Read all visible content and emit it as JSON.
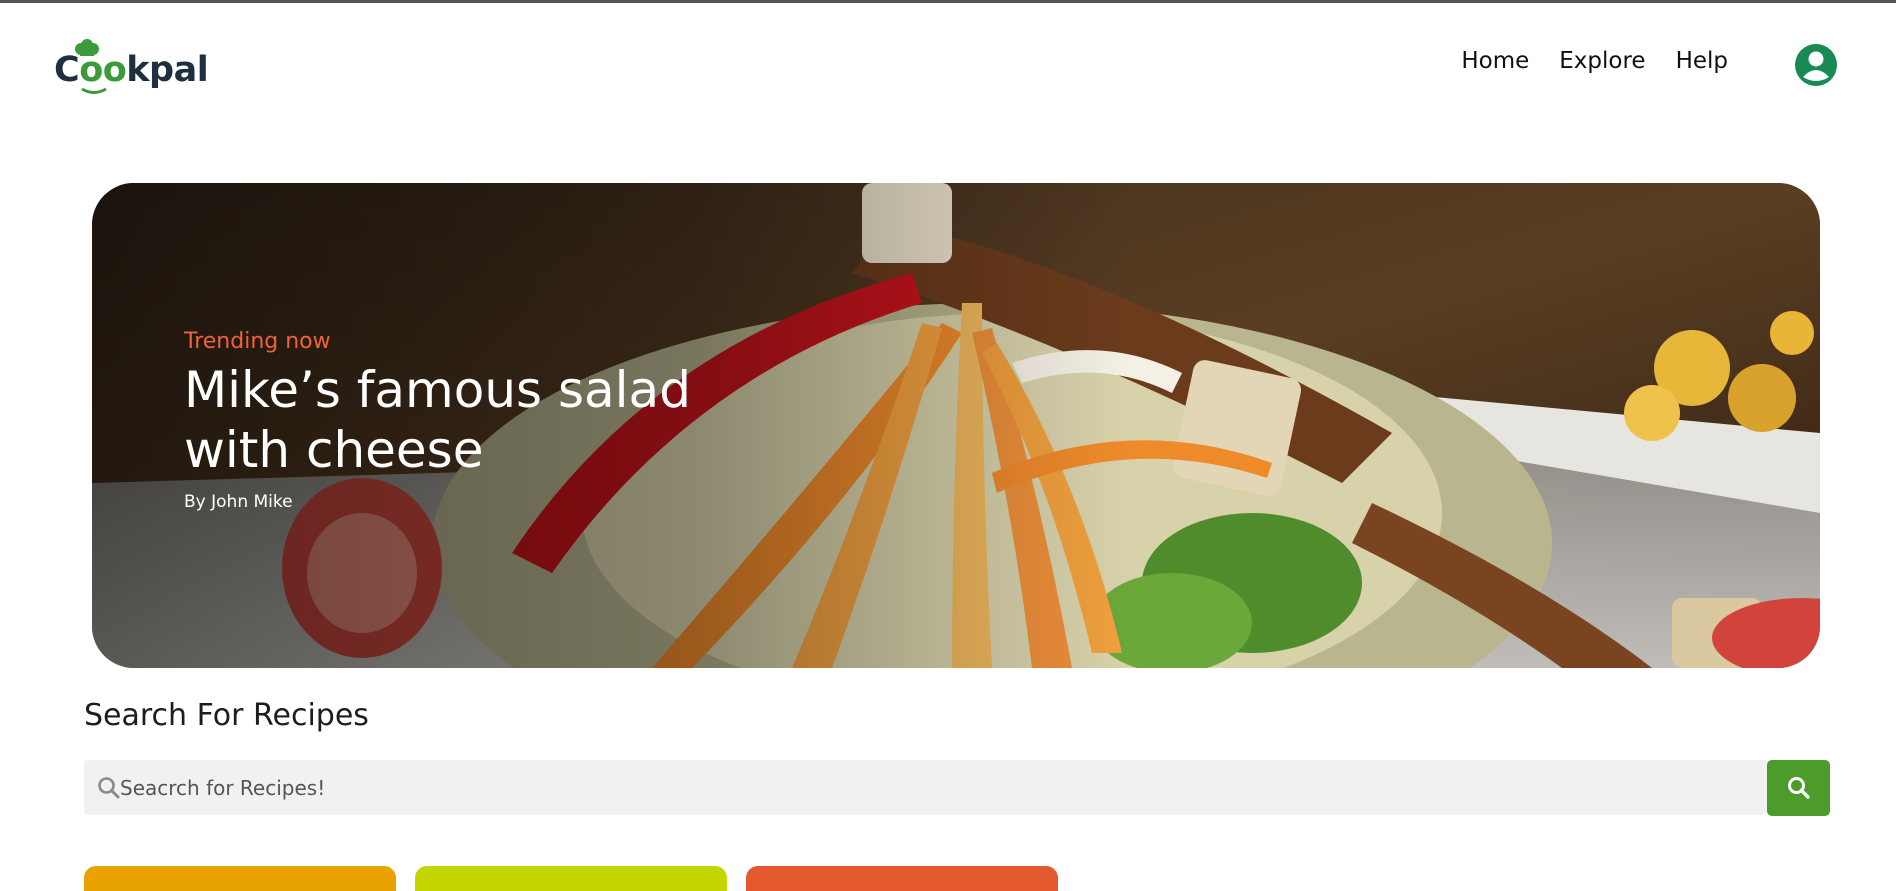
{
  "brand": {
    "name_part1": "C",
    "name_part2": "oo",
    "name_part3": "kpal",
    "green": "#3d9a3a",
    "dark": "#1f2f3f"
  },
  "nav": {
    "items": [
      {
        "label": "Home"
      },
      {
        "label": "Explore"
      },
      {
        "label": "Help"
      }
    ]
  },
  "hero": {
    "tag": "Trending now",
    "title_line1": "Mike’s famous salad",
    "title_line2": "with cheese",
    "author": "By John Mike",
    "tag_color": "#f0613a"
  },
  "search": {
    "heading": "Search For Recipes",
    "placeholder": "Seacrch for Recipes!",
    "value": "",
    "button_color": "#4c9b2b"
  },
  "categories": [
    {
      "color": "#e9a300"
    },
    {
      "color": "#c4d600"
    },
    {
      "color": "#e3582c"
    }
  ],
  "icons": {
    "avatar": "user-circle-icon",
    "search": "search-icon",
    "chef_hat": "chef-hat-icon"
  }
}
